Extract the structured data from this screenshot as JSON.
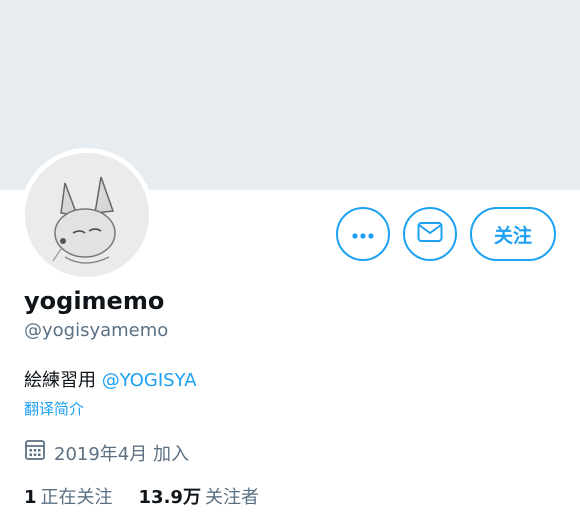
{
  "profile": {
    "display_name": "yogimemo",
    "handle": "@yogisyamemo",
    "bio_text": "絵練習用 ",
    "bio_mention": "@YOGISYA",
    "translate_label": "翻译简介",
    "joined": "2019年4月 加入"
  },
  "actions": {
    "more_icon": "more-icon",
    "mail_icon": "mail-icon",
    "follow_label": "关注"
  },
  "stats": {
    "following_count": "1",
    "following_label": "正在关注",
    "followers_count": "13.9万",
    "followers_label": "关注者"
  },
  "colors": {
    "accent": "#1da1f2",
    "banner": "#e6ecf0",
    "secondary_text": "#5b7083"
  }
}
